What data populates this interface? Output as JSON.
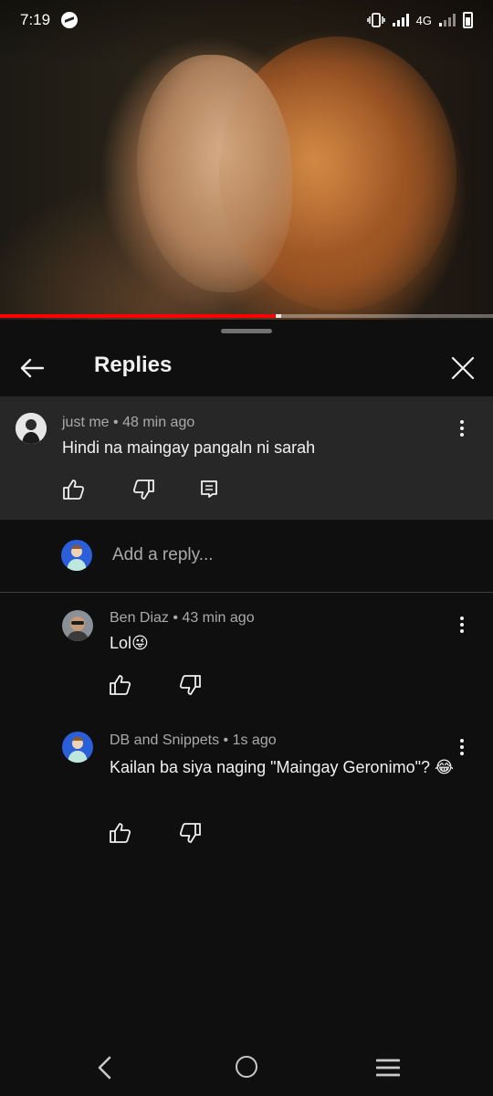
{
  "status_bar": {
    "time": "7:19",
    "network": "4G"
  },
  "video": {
    "progress_fraction": 0.56,
    "buffered_fraction": 0.57
  },
  "panel": {
    "title": "Replies"
  },
  "parent_comment": {
    "author": "just me",
    "age": "48 min ago",
    "text": "Hindi na maingay pangaln ni sarah"
  },
  "reply_input": {
    "placeholder": "Add a reply..."
  },
  "replies": [
    {
      "author": "Ben Diaz",
      "age": "43 min ago",
      "text": "Lol😜"
    },
    {
      "author": "DB and Snippets",
      "age": "1s ago",
      "text": "Kailan ba siya naging \"Maingay Geronimo\"? 😂"
    }
  ],
  "icons": {
    "back": "arrow-left-icon",
    "close": "close-icon",
    "like": "thumbs-up-icon",
    "dislike": "thumbs-down-icon",
    "reply": "comment-icon",
    "more": "more-vert-icon"
  },
  "colors": {
    "progress": "#ff0000",
    "background": "#0f0f0f",
    "parent_bg": "#272727"
  }
}
